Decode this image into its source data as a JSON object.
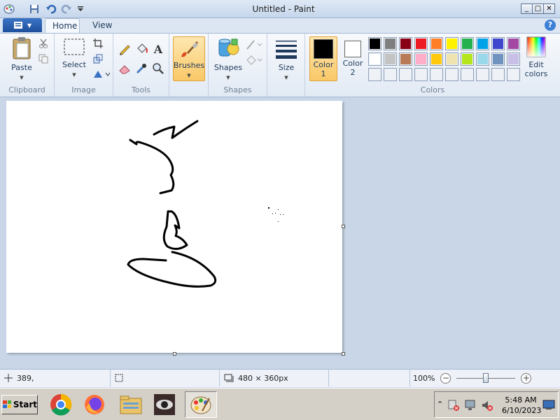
{
  "window": {
    "title": "Untitled - Paint",
    "minimize": "_",
    "maximize": "□",
    "close": "✕"
  },
  "tabs": {
    "file_icon": "menu-icon",
    "home": "Home",
    "view": "View",
    "help": "?"
  },
  "ribbon": {
    "clipboard": {
      "label": "Clipboard",
      "paste": "Paste"
    },
    "image": {
      "label": "Image",
      "select": "Select"
    },
    "tools": {
      "label": "Tools"
    },
    "brushes": "Brushes",
    "shapes": {
      "label": "Shapes",
      "button": "Shapes"
    },
    "size": "Size",
    "colors": {
      "label": "Colors",
      "color1": "Color 1",
      "color2": "Color 2",
      "edit": "Edit colors",
      "color1_value": "#000000",
      "color2_value": "#ffffff",
      "palette_row1": [
        "#000000",
        "#7f7f7f",
        "#880015",
        "#ed1c24",
        "#ff7f27",
        "#fff200",
        "#22b14c",
        "#00a2e8",
        "#3f48cc",
        "#a349a4"
      ],
      "palette_row2": [
        "#ffffff",
        "#c3c3c3",
        "#b97a57",
        "#ffaec9",
        "#ffc90e",
        "#efe4b0",
        "#b5e61d",
        "#99d9ea",
        "#7092be",
        "#c8bfe7"
      ]
    }
  },
  "status": {
    "cursor_pos": "389,",
    "selection_size": "",
    "canvas_size": "480 × 360px",
    "zoom": "100%",
    "zoom_level": 0.5
  },
  "taskbar": {
    "start": "Start",
    "time": "5:48 AM",
    "date": "6/10/2023"
  }
}
